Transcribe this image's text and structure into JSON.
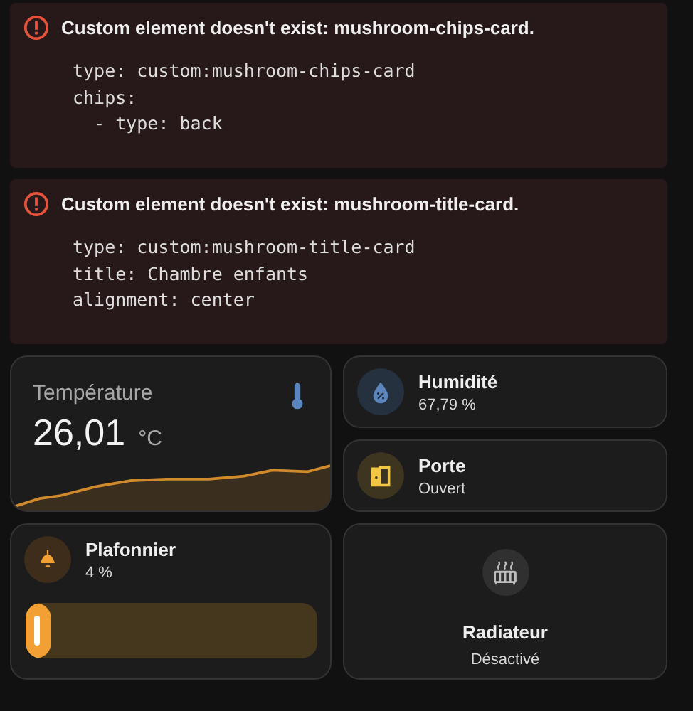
{
  "errors": [
    {
      "title": "Custom element doesn't exist: mushroom-chips-card.",
      "config": [
        "type: custom:mushroom-chips-card",
        "chips:",
        "  - type: back"
      ]
    },
    {
      "title": "Custom element doesn't exist: mushroom-title-card.",
      "config": [
        "type: custom:mushroom-title-card",
        "title: Chambre enfants",
        "alignment: center"
      ]
    }
  ],
  "sensor": {
    "name": "Température",
    "value": "26,01",
    "unit": "°C"
  },
  "entities": [
    {
      "kind": "humidity",
      "name": "Humidité",
      "state": "67,79 %"
    },
    {
      "kind": "door",
      "name": "Porte",
      "state": "Ouvert"
    }
  ],
  "light": {
    "name": "Plafonnier",
    "state": "4 %",
    "level": 0.04
  },
  "radiator": {
    "name": "Radiateur",
    "state": "Désactivé"
  }
}
